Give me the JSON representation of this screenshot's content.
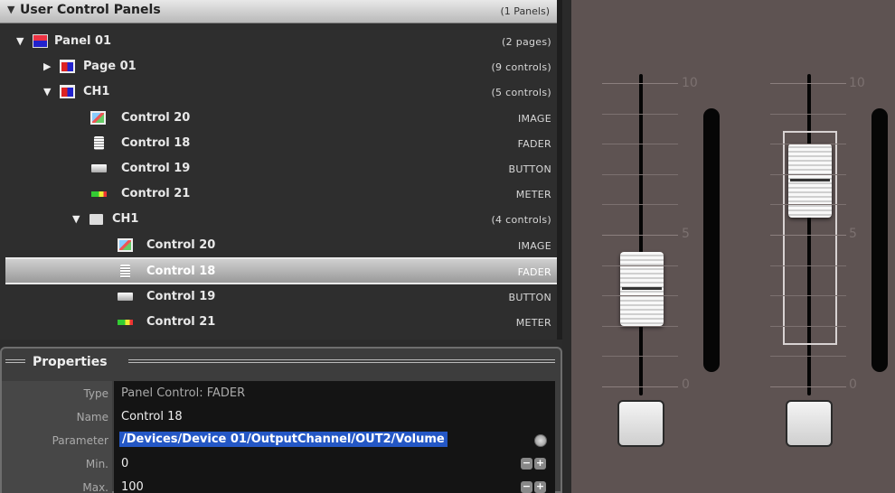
{
  "tree": {
    "header": {
      "title": "User Control Panels",
      "count": "(1 Panels)"
    },
    "rows": [
      {
        "label": "Panel 01",
        "type": "(2 pages)"
      },
      {
        "label": "Page 01",
        "type": "(9 controls)"
      },
      {
        "label": "CH1",
        "type": "(5 controls)"
      },
      {
        "label": "Control 20",
        "type": "IMAGE"
      },
      {
        "label": "Control 18",
        "type": "FADER"
      },
      {
        "label": "Control 19",
        "type": "BUTTON"
      },
      {
        "label": "Control 21",
        "type": "METER"
      },
      {
        "label": "CH1",
        "type": "(4 controls)"
      },
      {
        "label": "Control 20",
        "type": "IMAGE"
      },
      {
        "label": "Control 18",
        "type": "FADER"
      },
      {
        "label": "Control 19",
        "type": "BUTTON"
      },
      {
        "label": "Control 21",
        "type": "METER"
      }
    ],
    "selected_row": "Control 18"
  },
  "properties": {
    "title": "Properties",
    "rows": [
      {
        "key": "Type",
        "value": "Panel Control: FADER"
      },
      {
        "key": "Name",
        "value": "Control 18"
      },
      {
        "key": "Parameter",
        "value": "/Devices/Device 01/OutputChannel/OUT2/Volume"
      },
      {
        "key": "Min.",
        "value": "0"
      },
      {
        "key": "Max.",
        "value": "100"
      }
    ],
    "minus": "−",
    "plus": "+"
  },
  "faders": {
    "scale": {
      "top": "10",
      "mid": "5",
      "bottom": "0"
    },
    "fader1_level": 0.32,
    "fader2_level": 0.68
  },
  "colors": {
    "canvas_bg": "#5e5352",
    "selection_blue": "#2457c5"
  }
}
